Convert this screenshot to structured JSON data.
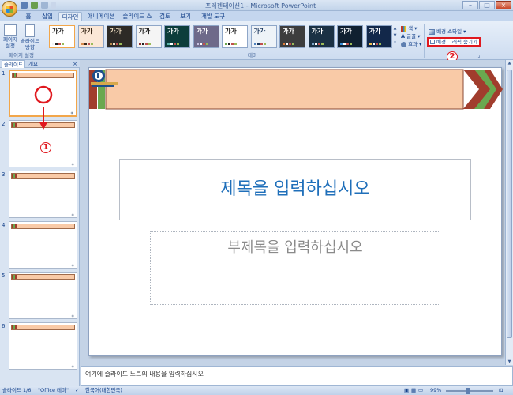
{
  "window": {
    "title": "프레젠테이션1 - Microsoft PowerPoint",
    "controls": [
      "–",
      "□",
      "×"
    ]
  },
  "tabs": [
    {
      "label": "홈",
      "active": false
    },
    {
      "label": "삽입",
      "active": false
    },
    {
      "label": "디자인",
      "active": true
    },
    {
      "label": "애니메이션",
      "active": false
    },
    {
      "label": "슬라이드 쇼",
      "active": false
    },
    {
      "label": "검토",
      "active": false
    },
    {
      "label": "보기",
      "active": false
    },
    {
      "label": "개발 도구",
      "active": false
    }
  ],
  "ribbon": {
    "page_setup": {
      "page_setup_label": "페이지 설정",
      "orientation_label": "슬라이드 방향",
      "group_label": "페이지 설정"
    },
    "themes": {
      "group_label": "테마",
      "sample_text": "가가",
      "items": [
        {
          "bg": "#ffffff",
          "fg": "#222222",
          "accent": "#f2f2f2"
        },
        {
          "bg": "#fbe7d6",
          "fg": "#3a2a1a",
          "accent": "#d88a4c"
        },
        {
          "bg": "#2d2a26",
          "fg": "#f4e2c4",
          "accent": "#b5894a"
        },
        {
          "bg": "#f5f5f5",
          "fg": "#222222",
          "accent": "#8a2b2b"
        },
        {
          "bg": "#0c3d3b",
          "fg": "#ffffff",
          "accent": "#5bb3a9"
        },
        {
          "bg": "#6e6a8a",
          "fg": "#ffffff",
          "accent": "#c7c2e0"
        },
        {
          "bg": "#ffffff",
          "fg": "#222222",
          "accent": "#6aa84f"
        },
        {
          "bg": "#eef3f8",
          "fg": "#1f3a60",
          "accent": "#4f81bd"
        },
        {
          "bg": "#3d3d3d",
          "fg": "#ffffff",
          "accent": "#e07b39"
        },
        {
          "bg": "#1b3144",
          "fg": "#ffffff",
          "accent": "#7fa7c9"
        },
        {
          "bg": "#102030",
          "fg": "#ffffff",
          "accent": "#3a8fd8"
        },
        {
          "bg": "#12284a",
          "fg": "#ffffff",
          "accent": "#f2c14e"
        }
      ]
    },
    "theme_options": {
      "colors": "색",
      "fonts": "글꼴",
      "effects": "효과"
    },
    "background": {
      "styles": "배경 스타일",
      "hide_graphics": "배경 그래픽 숨기기",
      "hide_graphics_checked": false
    }
  },
  "annotations": {
    "marker_1": "1",
    "marker_2": "2"
  },
  "slide_panel": {
    "tab_slides": "슬라이드",
    "tab_outline": "개요",
    "close": "×",
    "slides": [
      "1",
      "2",
      "3",
      "4",
      "5",
      "6"
    ],
    "selected": 1
  },
  "slide": {
    "title_placeholder": "제목을 입력하십시오",
    "subtitle_placeholder": "부제목을 입력하십시오"
  },
  "notes": {
    "placeholder": "여기에 슬라이드 노트의 내용을 입력하십시오"
  },
  "status": {
    "slide_info": "슬라이드 1/6",
    "theme": "\"Office 테마\"",
    "language": "한국어(대한민국)",
    "zoom": "99%"
  },
  "colors": {
    "accent_red": "#e0191f",
    "title_blue": "#1f6fba",
    "band_peach": "#f9caa7",
    "band_green": "#6aa84f",
    "band_maroon": "#a13d2d"
  }
}
